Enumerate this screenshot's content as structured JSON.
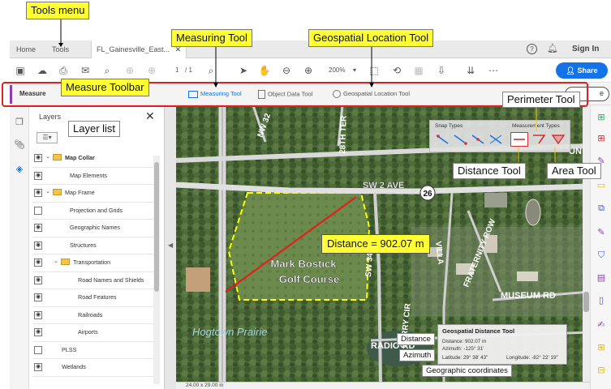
{
  "window": {
    "tabs": {
      "home": "Home",
      "tools": "Tools",
      "document": "FL_Gainesville_East..."
    },
    "sign_in": "Sign In",
    "page_current": "1",
    "page_total": "/ 1",
    "zoom": "200%",
    "share_label": "Share"
  },
  "measure_toolbar": {
    "title": "Measure",
    "tools": {
      "measuring": "Measuring Tool",
      "object_data": "Object Data Tool",
      "geospatial": "Geospatial Location Tool"
    },
    "close_partial": "e"
  },
  "layers_panel": {
    "title": "Layers",
    "items": [
      {
        "label": "Map Collar",
        "bold": true,
        "expanded": true,
        "folder": true,
        "visible": true
      },
      {
        "label": "Map Elements",
        "visible": true
      },
      {
        "label": "Map Frame",
        "expanded": true,
        "folder": true,
        "visible": true
      },
      {
        "label": "Projection and Grids",
        "visible": false
      },
      {
        "label": "Geographic Names",
        "visible": true
      },
      {
        "label": "Structures",
        "visible": true
      },
      {
        "label": "Transportation",
        "expanded": true,
        "folder": true,
        "visible": true
      },
      {
        "label": "Road Names and Shields",
        "visible": true
      },
      {
        "label": "Road Features",
        "visible": true
      },
      {
        "label": "Railroads",
        "visible": true
      },
      {
        "label": "Airports",
        "visible": true
      },
      {
        "label": "PLSS",
        "visible": false
      },
      {
        "label": "Wetlands",
        "visible": true
      }
    ]
  },
  "map": {
    "labels": {
      "sw2ave": "SW 2 AVE",
      "shield": "26",
      "golf": "Mark Bostick",
      "golf2": "Golf Course",
      "radio": "RADIO RD",
      "museum": "MUSEUM RD",
      "fraternity": "FRATERNITY ROW",
      "corry": "CORRY CIR",
      "hogtown": "Hogtown Prairie",
      "nw32": "NW 32",
      "st28": "28TH TER",
      "sw34": "SW 34 ST",
      "villa": "VILLA",
      "un": "UN"
    },
    "snap_types_label": "Snap Types",
    "measurement_types_label": "Measurement Types",
    "distance_readout": "Distance = 902.07 m",
    "popup": {
      "title": "Geospatial Distance Tool",
      "distance": "Distance: 902.07 m",
      "azimuth": "Azimuth: -125° 31'",
      "latitude": "Latitude: 29° 38' 43\"",
      "longitude": "Longitude: -82° 22' 19\""
    },
    "status_size": "24.00 x 29.00 in"
  },
  "annotations": {
    "tools_menu": "Tools menu",
    "measuring_tool": "Measuring Tool",
    "geospatial_location_tool": "Geospatial Location Tool",
    "measure_toolbar": "Measure Toolbar",
    "layer_list": "Layer list",
    "perimeter_tool": "Perimeter Tool",
    "distance_tool": "Distance Tool",
    "area_tool": "Area Tool",
    "distance": "Distance",
    "azimuth": "Azimuth",
    "geographic_coordinates": "Geographic coordinates"
  },
  "colors": {
    "accent_blue": "#1473e6",
    "measure_accent": "#8c3fb0",
    "annotation_yellow": "#ffff33",
    "annotation_red": "#e02020",
    "measure_line": "#e02020",
    "golf_outline": "#ffff00"
  }
}
